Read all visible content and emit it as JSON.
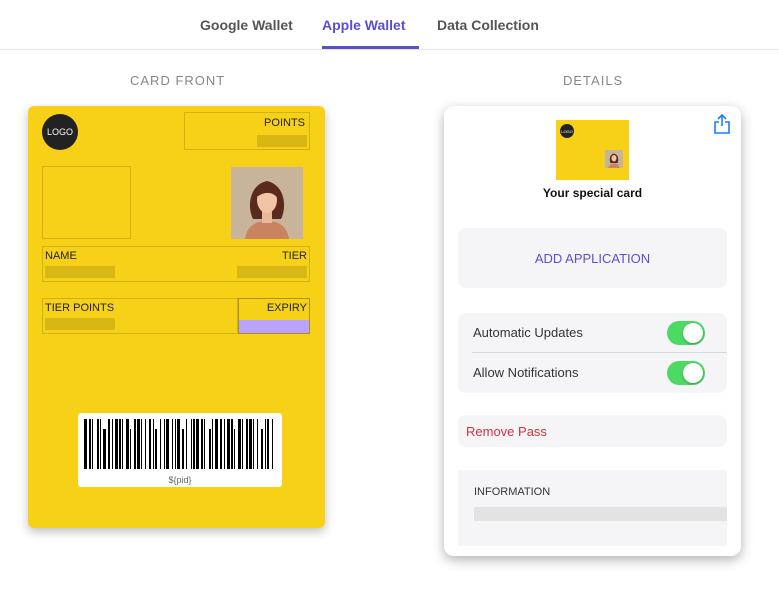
{
  "tabs": [
    {
      "label": "Google Wallet"
    },
    {
      "label": "Apple Wallet"
    },
    {
      "label": "Data Collection"
    }
  ],
  "active_tab": "Apple Wallet",
  "sections": {
    "front": "CARD FRONT",
    "details": "DETAILS"
  },
  "card": {
    "logo": "LOGO",
    "points_label": "POINTS",
    "name_label": "NAME",
    "tier_label": "TIER",
    "tier_points_label": "TIER POINTS",
    "expiry_label": "EXPIRY",
    "barcode_text": "${pid}",
    "background_color": "#f6d117"
  },
  "details": {
    "mini_logo": "LOGO",
    "card_name": "Your special card",
    "add_application": "ADD APPLICATION",
    "toggles": [
      {
        "label": "Automatic Updates",
        "on": true
      },
      {
        "label": "Allow Notifications",
        "on": true
      }
    ],
    "remove_pass": "Remove Pass",
    "information_label": "INFORMATION"
  },
  "colors": {
    "accent": "#5b4fd1",
    "toggle_on": "#4cd964",
    "danger": "#d0343a",
    "expiry_highlight": "#b9a3ff"
  }
}
